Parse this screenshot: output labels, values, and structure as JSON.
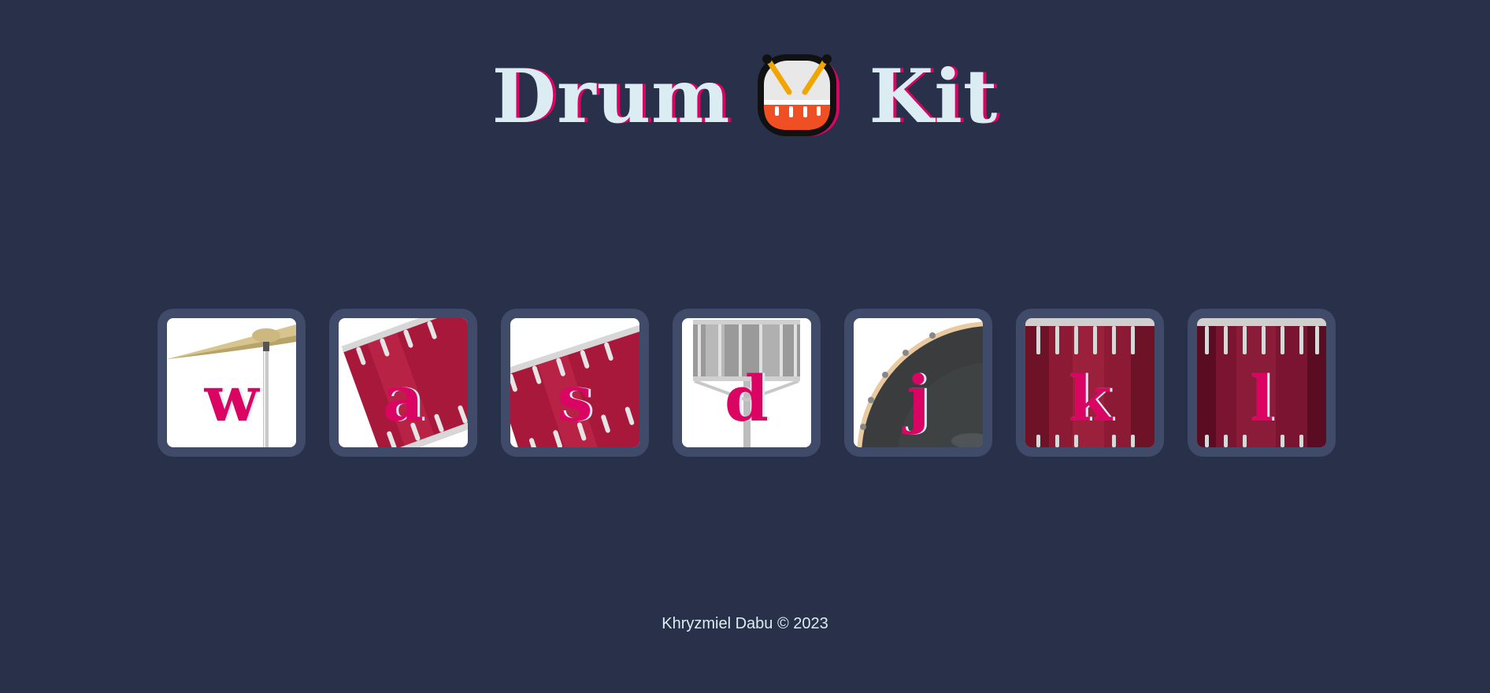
{
  "title": {
    "word_left": "Drum",
    "word_right": "Kit",
    "emoji_icon": "drum-with-drumsticks-icon"
  },
  "drums": [
    {
      "key": "w",
      "image": "crash-cymbal"
    },
    {
      "key": "a",
      "image": "tom-1"
    },
    {
      "key": "s",
      "image": "tom-2"
    },
    {
      "key": "d",
      "image": "snare"
    },
    {
      "key": "j",
      "image": "kick-bass"
    },
    {
      "key": "k",
      "image": "tom-3"
    },
    {
      "key": "l",
      "image": "tom-4"
    }
  ],
  "footer": {
    "text": "Khryzmiel Dabu © 2023"
  },
  "colors": {
    "background": "#283149",
    "button_frame": "#404b69",
    "accent": "#da0463",
    "title_text": "#dbedf3"
  }
}
